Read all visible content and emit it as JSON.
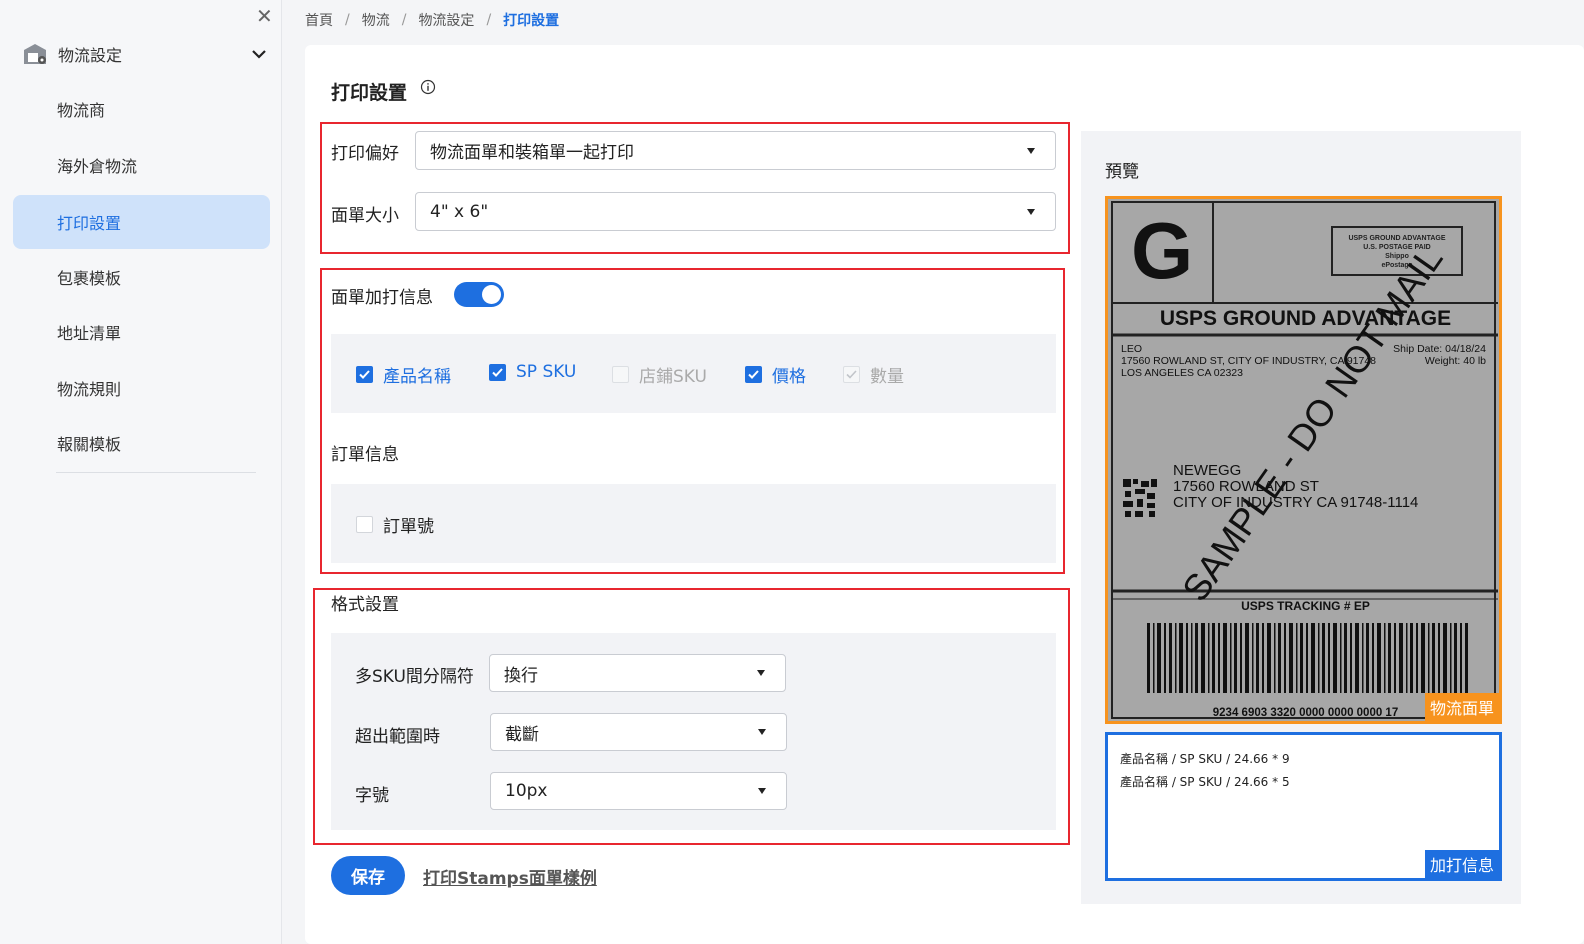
{
  "sidebar": {
    "group_label": "物流設定",
    "items": [
      {
        "label": "物流商"
      },
      {
        "label": "海外倉物流"
      },
      {
        "label": "打印設置"
      },
      {
        "label": "包裹模板"
      },
      {
        "label": "地址清單"
      },
      {
        "label": "物流規則"
      },
      {
        "label": "報關模板"
      }
    ]
  },
  "breadcrumb": [
    "首頁",
    "物流",
    "物流設定",
    "打印設置"
  ],
  "page": {
    "title": "打印設置",
    "print_pref_label": "打印偏好",
    "print_pref_value": "物流面單和裝箱單一起打印",
    "label_size_label": "面單大小",
    "label_size_value": "4\" x 6\"",
    "extra_info_label": "面單加打信息",
    "extra_info_enabled": true,
    "extra_options": [
      {
        "label": "產品名稱",
        "checked": true,
        "disabled": false
      },
      {
        "label": "SP SKU",
        "checked": true,
        "disabled": false
      },
      {
        "label": "店鋪SKU",
        "checked": false,
        "disabled": true
      },
      {
        "label": "價格",
        "checked": true,
        "disabled": false
      },
      {
        "label": "數量",
        "checked": true,
        "disabled": true
      }
    ],
    "order_info_label": "訂單信息",
    "order_option": {
      "label": "訂單號",
      "checked": false
    },
    "format_label": "格式設置",
    "sku_sep_label": "多SKU間分隔符",
    "sku_sep_value": "換行",
    "overflow_label": "超出範圍時",
    "overflow_value": "截斷",
    "font_size_label": "字號",
    "font_size_value": "10px",
    "save_label": "保存",
    "sample_link_label": "打印Stamps面單樣例"
  },
  "preview": {
    "title": "預覽",
    "label": {
      "big_letter": "G",
      "postage_lines": [
        "USPS GROUND ADVANTAGE",
        "U.S. POSTAGE PAID",
        "Shippo",
        "ePostage"
      ],
      "service": "USPS GROUND ADVANTAGE",
      "from_lines": [
        "LEO",
        "17560 ROWLAND ST, CITY OF INDUSTRY, CA 91748",
        "LOS ANGELES CA 02323"
      ],
      "ship_date": "Ship Date: 04/18/24",
      "weight": "Weight: 40 lb",
      "to_lines": [
        "NEWEGG",
        "17560 ROWLAND ST",
        "CITY OF INDUSTRY CA 91748-1114"
      ],
      "watermark": "SAMPLE - DO NOT MAIL",
      "tracking_title": "USPS TRACKING # EP",
      "tracking_number": "9234 6903 3320 0000 0000 0000 17"
    },
    "label_tag": "物流面單",
    "extra_lines": [
      "產品名稱 / SP SKU / 24.66 * 9",
      "產品名稱 / SP SKU / 24.66 * 5"
    ],
    "extra_tag": "加打信息"
  },
  "colors": {
    "accent": "#1e6fe0",
    "highlight_box": "#e8262f",
    "label_frame": "#f7931e"
  }
}
